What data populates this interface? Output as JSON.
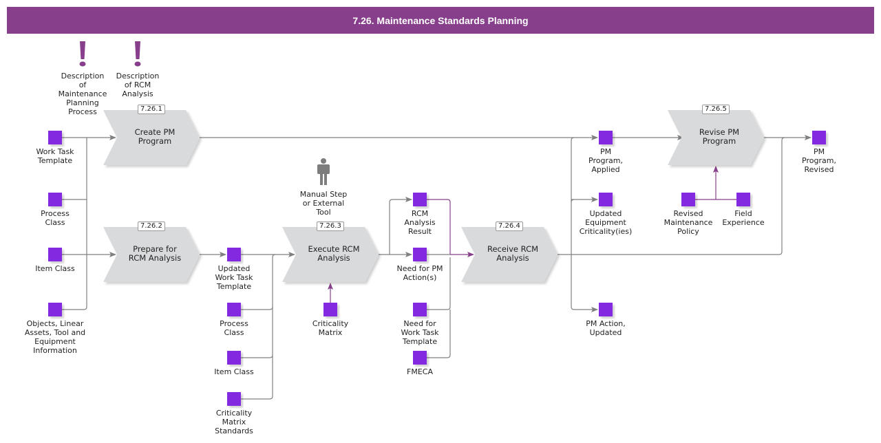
{
  "header": {
    "title": "7.26. Maintenance Standards Planning"
  },
  "colors": {
    "header": "#873f8b",
    "object": "#8329e0",
    "process": "#d9dadb",
    "line": "#808080",
    "highlight": "#873f8b"
  },
  "notes": [
    {
      "id": "n1",
      "icon": "exclamation-icon",
      "label": "Description\nof\nMaintenance\nPlanning\nProcess"
    },
    {
      "id": "n2",
      "icon": "exclamation-icon",
      "label": "Description\nof RCM\nAnalysis"
    }
  ],
  "manual": {
    "icon": "person-icon",
    "label": "Manual Step\nor External\nTool"
  },
  "processes": [
    {
      "id": "p1",
      "number": "7.26.1",
      "label": "Create PM\nProgram"
    },
    {
      "id": "p2",
      "number": "7.26.2",
      "label": "Prepare for\nRCM Analysis"
    },
    {
      "id": "p3",
      "number": "7.26.3",
      "label": "Execute RCM\nAnalysis"
    },
    {
      "id": "p4",
      "number": "7.26.4",
      "label": "Receive RCM\nAnalysis"
    },
    {
      "id": "p5",
      "number": "7.26.5",
      "label": "Revise PM\nProgram"
    }
  ],
  "objects": [
    {
      "id": "o1",
      "label": "Work Task\nTemplate"
    },
    {
      "id": "o2",
      "label": "Process\nClass"
    },
    {
      "id": "o3",
      "label": "Item Class"
    },
    {
      "id": "o4",
      "label": "Objects, Linear\nAssets, Tool and\nEquipment\nInformation"
    },
    {
      "id": "o5",
      "label": "Updated\nWork Task\nTemplate"
    },
    {
      "id": "o6",
      "label": "Process\nClass"
    },
    {
      "id": "o7",
      "label": "Item Class"
    },
    {
      "id": "o8",
      "label": "Criticality\nMatrix\nStandards"
    },
    {
      "id": "o9",
      "label": "Criticality\nMatrix"
    },
    {
      "id": "o10",
      "label": "RCM\nAnalysis\nResult"
    },
    {
      "id": "o11",
      "label": "Need for PM\nAction(s)"
    },
    {
      "id": "o12",
      "label": "Need for\nWork Task\nTemplate"
    },
    {
      "id": "o13",
      "label": "FMECA"
    },
    {
      "id": "o14",
      "label": "PM\nProgram,\nApplied"
    },
    {
      "id": "o15",
      "label": "Updated\nEquipment\nCriticality(ies)"
    },
    {
      "id": "o16",
      "label": "PM Action,\nUpdated"
    },
    {
      "id": "o17",
      "label": "Revised\nMaintenance\nPolicy"
    },
    {
      "id": "o18",
      "label": "Field\nExperience"
    },
    {
      "id": "o19",
      "label": "PM\nProgram,\nRevised"
    }
  ]
}
